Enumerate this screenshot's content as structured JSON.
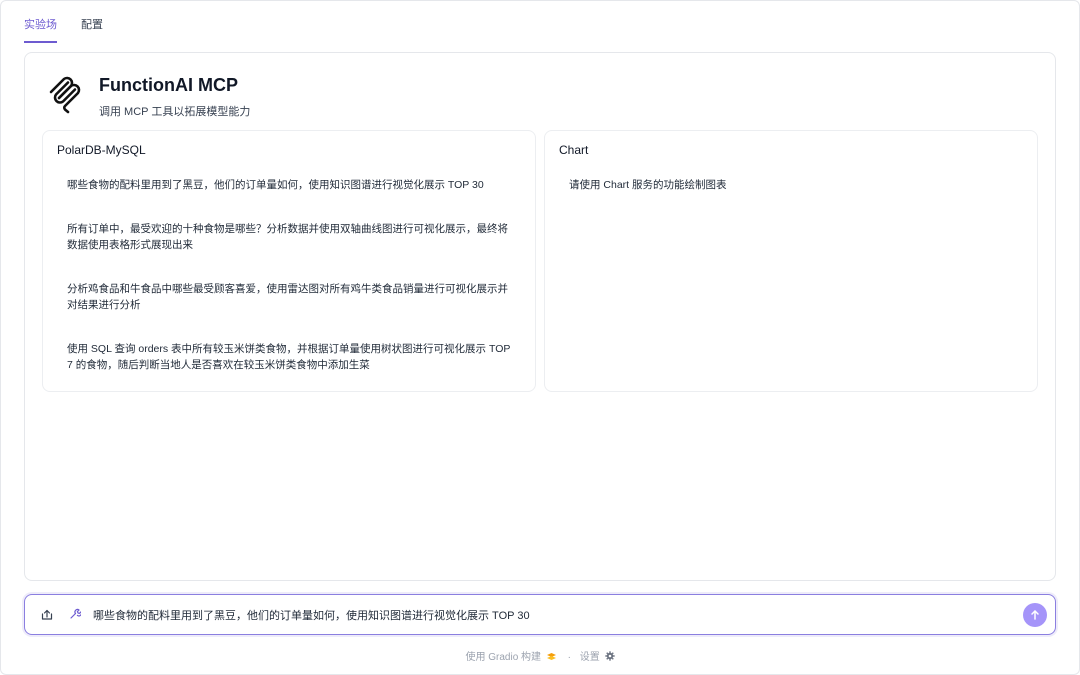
{
  "tabs": [
    {
      "label": "实验场",
      "active": true
    },
    {
      "label": "配置",
      "active": false
    }
  ],
  "header": {
    "title": "FunctionAI MCP",
    "subtitle": "调用 MCP 工具以拓展模型能力"
  },
  "cards": [
    {
      "title": "PolarDB-MySQL",
      "examples": [
        "哪些食物的配料里用到了黑豆，他们的订单量如何，使用知识图谱进行视觉化展示 TOP 30",
        "所有订单中，最受欢迎的十种食物是哪些？分析数据并使用双轴曲线图进行可视化展示，最终将数据使用表格形式展现出来",
        "分析鸡食品和牛食品中哪些最受顾客喜爱，使用雷达图对所有鸡牛类食品销量进行可视化展示并对结果进行分析",
        "使用 SQL 查询 orders 表中所有较玉米饼类食物，并根据订单量使用树状图进行可视化展示 TOP 7 的食物，随后判断当地人是否喜欢在较玉米饼类食物中添加生菜"
      ]
    },
    {
      "title": "Chart",
      "examples": [
        "请使用 Chart 服务的功能绘制图表"
      ]
    }
  ],
  "input": {
    "value": "哪些食物的配料里用到了黑豆，他们的订单量如何，使用知识图谱进行视觉化展示 TOP 30"
  },
  "footer": {
    "built_with": "使用 Gradio 构建",
    "separator": "·",
    "settings": "设置"
  },
  "colors": {
    "accent": "#6d5bd0",
    "send_button": "#a594f9",
    "input_border": "#8b7fe0"
  },
  "icons": {
    "upload": "upload-icon",
    "tools": "wrench-icon",
    "send": "arrow-up-icon",
    "logo": "mcp-logo-icon",
    "settings": "gear-icon",
    "gradio": "gradio-logo-icon"
  }
}
